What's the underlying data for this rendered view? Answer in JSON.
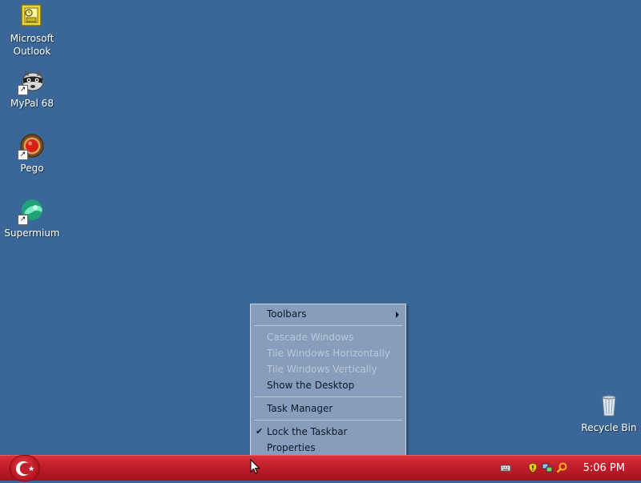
{
  "desktop": {
    "icons": [
      {
        "label_line1": "Microsoft",
        "label_line2": "Outlook"
      },
      {
        "label_line1": "MyPal 68"
      },
      {
        "label_line1": "Pego"
      },
      {
        "label_line1": "Supermium"
      },
      {
        "label_line1": "Recycle Bin"
      }
    ]
  },
  "context_menu": {
    "items": [
      {
        "label": "Toolbars",
        "has_submenu": true,
        "enabled": true
      },
      {
        "label": "Cascade Windows",
        "enabled": false
      },
      {
        "label": "Tile Windows Horizontally",
        "enabled": false
      },
      {
        "label": "Tile Windows Vertically",
        "enabled": false
      },
      {
        "label": "Show the Desktop",
        "enabled": true
      },
      {
        "label": "Task Manager",
        "enabled": true
      },
      {
        "label": "Lock the Taskbar",
        "checked": true,
        "enabled": true
      },
      {
        "label": "Properties",
        "enabled": true
      }
    ]
  },
  "taskbar": {
    "clock": "5:06 PM",
    "tray_icons": [
      "keyboard-icon",
      "security-shield-icon",
      "network-icon",
      "search-icon"
    ]
  },
  "colors": {
    "desktop_bg": "#3a6797",
    "taskbar": "#c11f2a",
    "menu_bg": "#8ca3be"
  }
}
